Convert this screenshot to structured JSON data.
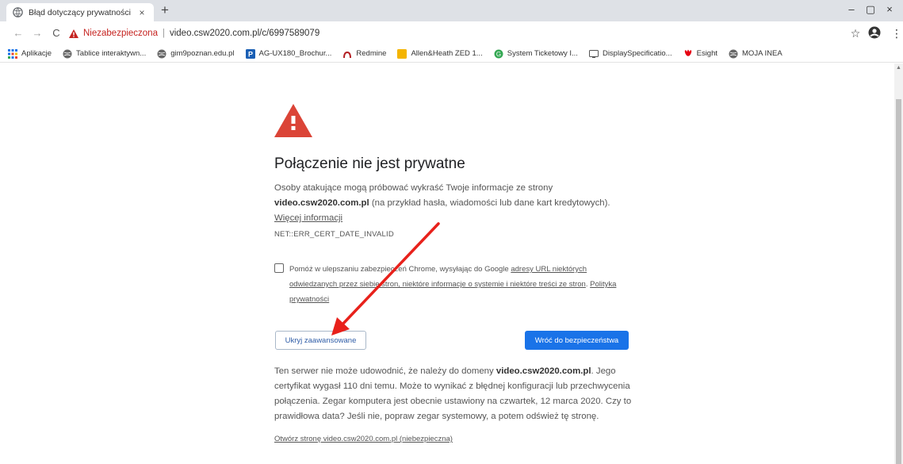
{
  "tab": {
    "title": "Błąd dotyczący prywatności",
    "close": "×",
    "new_tab": "+"
  },
  "window_controls": {
    "minimize": "–",
    "maximize": "▢",
    "close": "×"
  },
  "toolbar": {
    "back": "←",
    "forward": "→",
    "reload": "C",
    "security_label": "Niezabezpieczona",
    "separator": "|",
    "url": "video.csw2020.com.pl/c/6997589079",
    "star": "☆",
    "menu": "⋮"
  },
  "bookmarks": [
    {
      "label": "Aplikacje",
      "icon": "apps-grid-icon",
      "color": "#1a73e8"
    },
    {
      "label": "Tablice interaktywn...",
      "icon": "globe-icon",
      "color": "#666666"
    },
    {
      "label": "gim9poznan.edu.pl",
      "icon": "globe-icon",
      "color": "#666666"
    },
    {
      "label": "AG-UX180_Brochur...",
      "icon": "p-icon",
      "color": "#1a5fb4"
    },
    {
      "label": "Redmine",
      "icon": "redmine-icon",
      "color": "#b32024"
    },
    {
      "label": "Allen&Heath ZED 1...",
      "icon": "bookmark-yellow-icon",
      "color": "#f4b400"
    },
    {
      "label": "System Ticketowy I...",
      "icon": "ticket-icon",
      "color": "#34a853"
    },
    {
      "label": "DisplaySpecificatio...",
      "icon": "display-icon",
      "color": "#555555"
    },
    {
      "label": "Esight",
      "icon": "huawei-icon",
      "color": "#e60012"
    },
    {
      "label": "MOJA INEA",
      "icon": "globe-icon",
      "color": "#666666"
    }
  ],
  "page": {
    "heading": "Połączenie nie jest prywatne",
    "para_part1": "Osoby atakujące mogą próbować wykraść Twoje informacje ze strony",
    "para_domain": "video.csw2020.com.pl",
    "para_part2": "(na przykład hasła, wiadomości lub dane kart kredytowych).",
    "para_link": "Więcej informacji",
    "error_code": "NET::ERR_CERT_DATE_INVALID",
    "checkbox_text1": "Pomóż w ulepszaniu zabezpieczeń Chrome, wysyłając do Google",
    "checkbox_link1": "adresy URL niektórych odwiedzanych przez siebie stron, niektóre informacje o systemie i niektóre treści ze stron",
    "checkbox_text2": ".",
    "checkbox_link2": "Polityka prywatności",
    "advanced_button": "Ukryj zaawansowane",
    "back_button": "Wróć do bezpieczeństwa",
    "details_part1": "Ten serwer nie może udowodnić, że należy do domeny",
    "details_domain": "video.csw2020.com.pl",
    "details_part2": ". Jego certyfikat wygasł 110 dni temu. Może to wynikać z błędnej konfiguracji lub przechwycenia połączenia. Zegar komputera jest obecnie ustawiony na czwartek, 12 marca 2020. Czy to prawidłowa data? Jeśli nie, popraw zegar systemowy, a potem odśwież tę stronę.",
    "proceed_link": "Otwórz stronę video.csw2020.com.pl (niebezpieczna)"
  },
  "colors": {
    "warning_red": "#db4437",
    "insecure_red": "#c5221f",
    "primary_blue": "#1a73e8",
    "annotation_red": "#e8211b"
  }
}
